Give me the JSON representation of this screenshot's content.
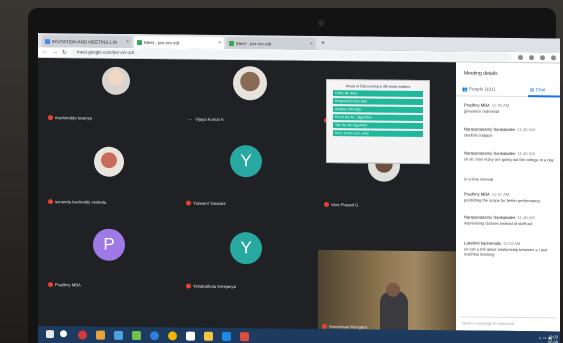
{
  "browser": {
    "tabs": [
      {
        "label": "INVITATION AND MEETING LIN",
        "fav": "#4285f4",
        "active": false
      },
      {
        "label": "Meet - pvr-vrv-zdr",
        "fav": "#34a853",
        "active": true
      },
      {
        "label": "Meet - pvr-vrv-zdr",
        "fav": "#34a853",
        "active": false
      }
    ],
    "new_tab": "+",
    "url": "meet.google.com/pvr-vrv-zdr"
  },
  "participants": [
    {
      "name": "mschireddy lavanya"
    },
    {
      "name": "Vijaya Kumar K"
    },
    {
      "name": "sunanda bavireddy venkata"
    },
    {
      "name": "Yaswant Yaswant",
      "letter": "Y"
    },
    {
      "name": "Vara Prasad G"
    },
    {
      "name": "Pradhny MBA",
      "letter": "P"
    },
    {
      "name": "Yekabathula Sreejanya",
      "letter": "Y"
    },
    {
      "name": "Sreechaan Mungara"
    }
  ],
  "presentation": {
    "title": "Areas of Discovering a 4th week matters",
    "rows": [
      "Color, fits data",
      "Respond for this data",
      "Analyse this data",
      "Fix on the M... Algorithm",
      "Tell, the ML Algorithm",
      "Do it, to the user, write"
    ]
  },
  "panel": {
    "header": "Meeting details",
    "tab_people": "People (101)",
    "tab_chat": "Chat",
    "messages": [
      {
        "who": "Pradhny MBA",
        "time": "11:45 AM",
        "body": "grievance redressal"
      },
      {
        "who": "Narayanasamy Sankaladen",
        "time": "11:45 AM",
        "body": "student outpace"
      },
      {
        "who": "Narayanasamy Sankaladen",
        "time": "11:46 AM",
        "body": "sir sir, how many are going out the college in a day"
      },
      {
        "who": "",
        "time": "",
        "body": "in a time interval"
      },
      {
        "who": "Pradhny MBA",
        "time": "11:47 AM",
        "body": "predicting the scope for better performance"
      },
      {
        "who": "Narayanasamy Sankaladen",
        "time": "11:48 AM",
        "body": "improvising classes instead of staff out"
      },
      {
        "who": "Lakshmi karimmallu",
        "time": "11:53 AM",
        "body": "sir can u tell about relationship between a.i and machine learning"
      }
    ],
    "send_placeholder": "Send a message to everyone"
  },
  "taskbar": {
    "clock_time": "12:03",
    "clock_date": "02-06"
  },
  "colors": {
    "letter_avatar_p": "#9f7ae6",
    "letter_avatar_y": "#27a8a0",
    "accent": "#1a73e8",
    "slide_row": "#1fb89a"
  }
}
